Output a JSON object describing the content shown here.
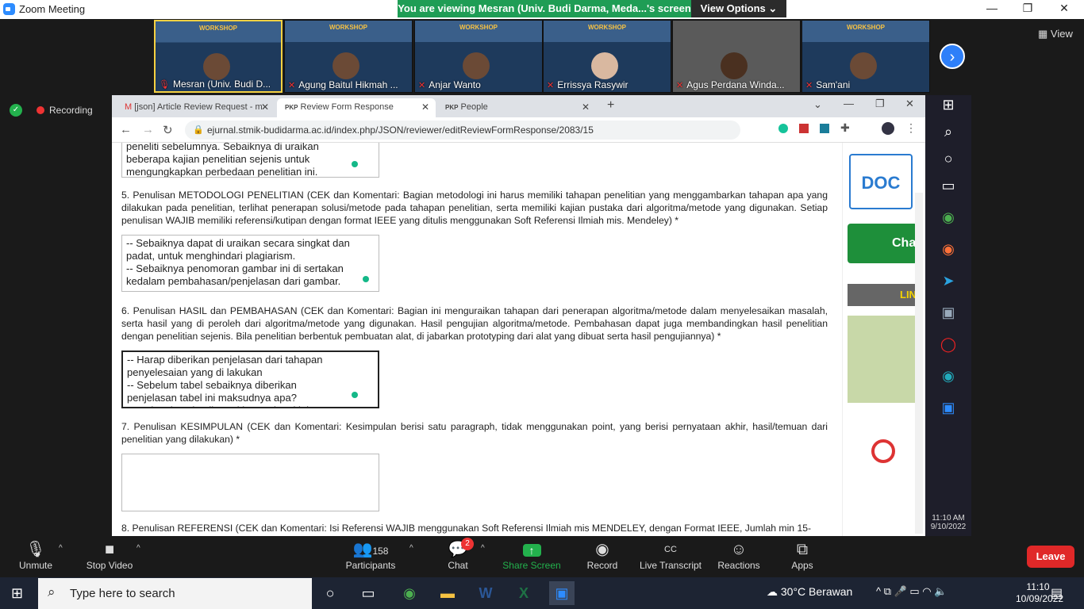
{
  "window_title": "Zoom Meeting",
  "banner": "You are viewing Mesran (Univ. Budi Darma, Meda...'s screen",
  "view_options": "View Options",
  "view_label": "View",
  "participants": [
    {
      "name": "Mesran (Univ. Budi D..."
    },
    {
      "name": "Agung Baitul Hikmah ..."
    },
    {
      "name": "Anjar Wanto"
    },
    {
      "name": "Errissya Rasywir"
    },
    {
      "name": "Agus Perdana Winda..."
    },
    {
      "name": "Sam'ani"
    }
  ],
  "workshop_text": "WORKSHOP",
  "recording": "Recording",
  "browser": {
    "tabs": [
      "[json] Article Review Request - m",
      "Review Form Response",
      "People"
    ],
    "url": "ejurnal.stmik-budidarma.ac.id/index.php/JSON/reviewer/editReviewFormResponse/2083/15"
  },
  "form": {
    "ta0": "peneliti sebelumnya.  Sebaiknya di uraikan\nbeberapa kajian penelitian sejenis untuk\nmengungkapkan perbedaan penelitian ini.",
    "q5": "5. Penulisan METODOLOGI PENELITIAN (CEK dan Komentari: Bagian metodologi ini harus memiliki tahapan penelitian yang menggambarkan tahapan apa yang dilakukan pada penelitian, terlihat penerapan solusi/metode pada tahapan penelitian, serta memiliki kajian pustaka dari algoritma/metode yang digunakan. Setiap penulisan WAJIB memiliki referensi/kutipan dengan format IEEE yang ditulis menggunakan Soft Referensi Ilmiah mis. Mendeley) *",
    "ta5": "-- Sebaiknya dapat di uraikan secara singkat dan\npadat, untuk menghindari plagiarism.\n-- Sebaiknya penomoran gambar ini di sertakan\nkedalam pembahasan/penjelasan dari gambar.",
    "q6": "6. Penulisan HASIL dan PEMBAHASAN (CEK dan Komentari: Bagian ini menguraikan tahapan dari penerapan algoritma/metode dalam menyelesaikan masalah, serta hasil yang di peroleh dari algoritma/metode yang digunakan. Hasil pengujian algoritma/metode. Pembahasan dapat juga membandingkan hasil penelitian dengan penelitian sejenis. Bila penelitian berbentuk pembuatan alat, di jabarkan prototyping dari alat yang dibuat serta hasil pengujiannya) *",
    "ta6": "-- Harap diberikan penjelasan dari tahapan\npenyelesaian yang di lakukan\n-- Sebelum tabel sebaiknya diberikan\npenjelasan tabel ini maksudnya apa?\n-- Maksudnya hasil rangking tertinggi ini apa?",
    "q7": "7. Penulisan KESIMPULAN (CEK dan Komentari: Kesimpulan berisi satu paragraph, tidak menggunakan point, yang berisi pernyataan akhir, hasil/temuan dari penelitian yang dilakukan) *",
    "ta7": "",
    "q8": "8. Penulisan REFERENSI (CEK dan Komentari: Isi Referensi WAJIB menggunakan Soft Referensi Ilmiah mis MENDELEY, dengan Format IEEE, Jumlah min 15-"
  },
  "side": {
    "doc": "DOC",
    "chat": "Cha",
    "lin": "LIN"
  },
  "win_clock": {
    "time": "11:10 AM",
    "date": "9/10/2022"
  },
  "toolbar": {
    "unmute": "Unmute",
    "stop_video": "Stop Video",
    "participants": "Participants",
    "participants_count": "158",
    "chat": "Chat",
    "chat_badge": "2",
    "share": "Share Screen",
    "record": "Record",
    "transcript": "Live Transcript",
    "reactions": "Reactions",
    "apps": "Apps",
    "leave": "Leave",
    "cc": "CC"
  },
  "taskbar": {
    "search_placeholder": "Type here to search",
    "weather": "30°C  Berawan",
    "time": "11:10",
    "date": "10/09/2022"
  }
}
